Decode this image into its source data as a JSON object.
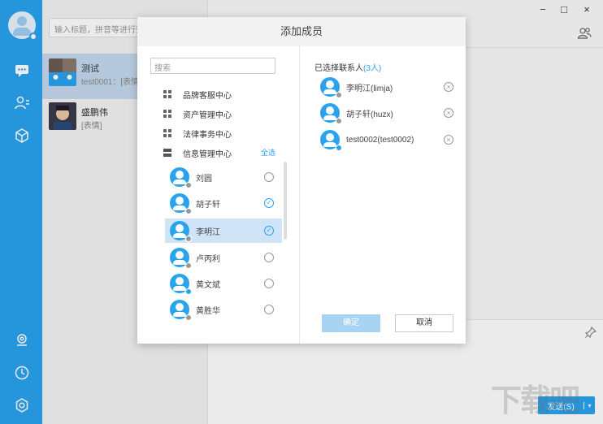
{
  "search": {
    "placeholder": "输入标题，拼音等进行查"
  },
  "conversations": [
    {
      "name": "测试",
      "preview": "test0001：[表情]"
    },
    {
      "name": "盛鹏伟",
      "preview": "[表情]"
    }
  ],
  "window_controls": {
    "minimize": "−",
    "maximize": "□",
    "close": "×"
  },
  "send_button": {
    "label": "发送(S)",
    "arrow": "▾"
  },
  "modal": {
    "title": "添加成员",
    "search_placeholder": "搜索",
    "departments": [
      "品牌客服中心",
      "资产管理中心",
      "法律事务中心",
      "信息管理中心"
    ],
    "select_all": "全选",
    "members": [
      {
        "name": "刘圆",
        "status": "offline",
        "checked": false
      },
      {
        "name": "胡子轩",
        "status": "offline",
        "checked": true
      },
      {
        "name": "李明江",
        "status": "offline",
        "checked": true
      },
      {
        "name": "卢丙利",
        "status": "offline",
        "checked": false
      },
      {
        "name": "黄文斌",
        "status": "online",
        "checked": false
      },
      {
        "name": "黄胜华",
        "status": "offline",
        "checked": false
      }
    ],
    "selected_title": "已选择联系人",
    "selected_count": "(3人)",
    "selected": [
      {
        "name": "李明江(limja)",
        "status": "offline"
      },
      {
        "name": "胡子轩(huzx)",
        "status": "offline"
      },
      {
        "name": "test0002(test0002)",
        "status": "online"
      }
    ],
    "ok_label": "确定",
    "cancel_label": "取消"
  },
  "icons": {
    "chat": "chat-bubble-icon",
    "contacts": "contacts-icon",
    "apps": "cube-icon",
    "location": "location-icon",
    "history": "clock-icon",
    "settings": "gear-icon"
  },
  "colors": {
    "accent": "#2aa3ef",
    "selected_row": "#cfe4f7"
  },
  "watermark": "下载吧"
}
